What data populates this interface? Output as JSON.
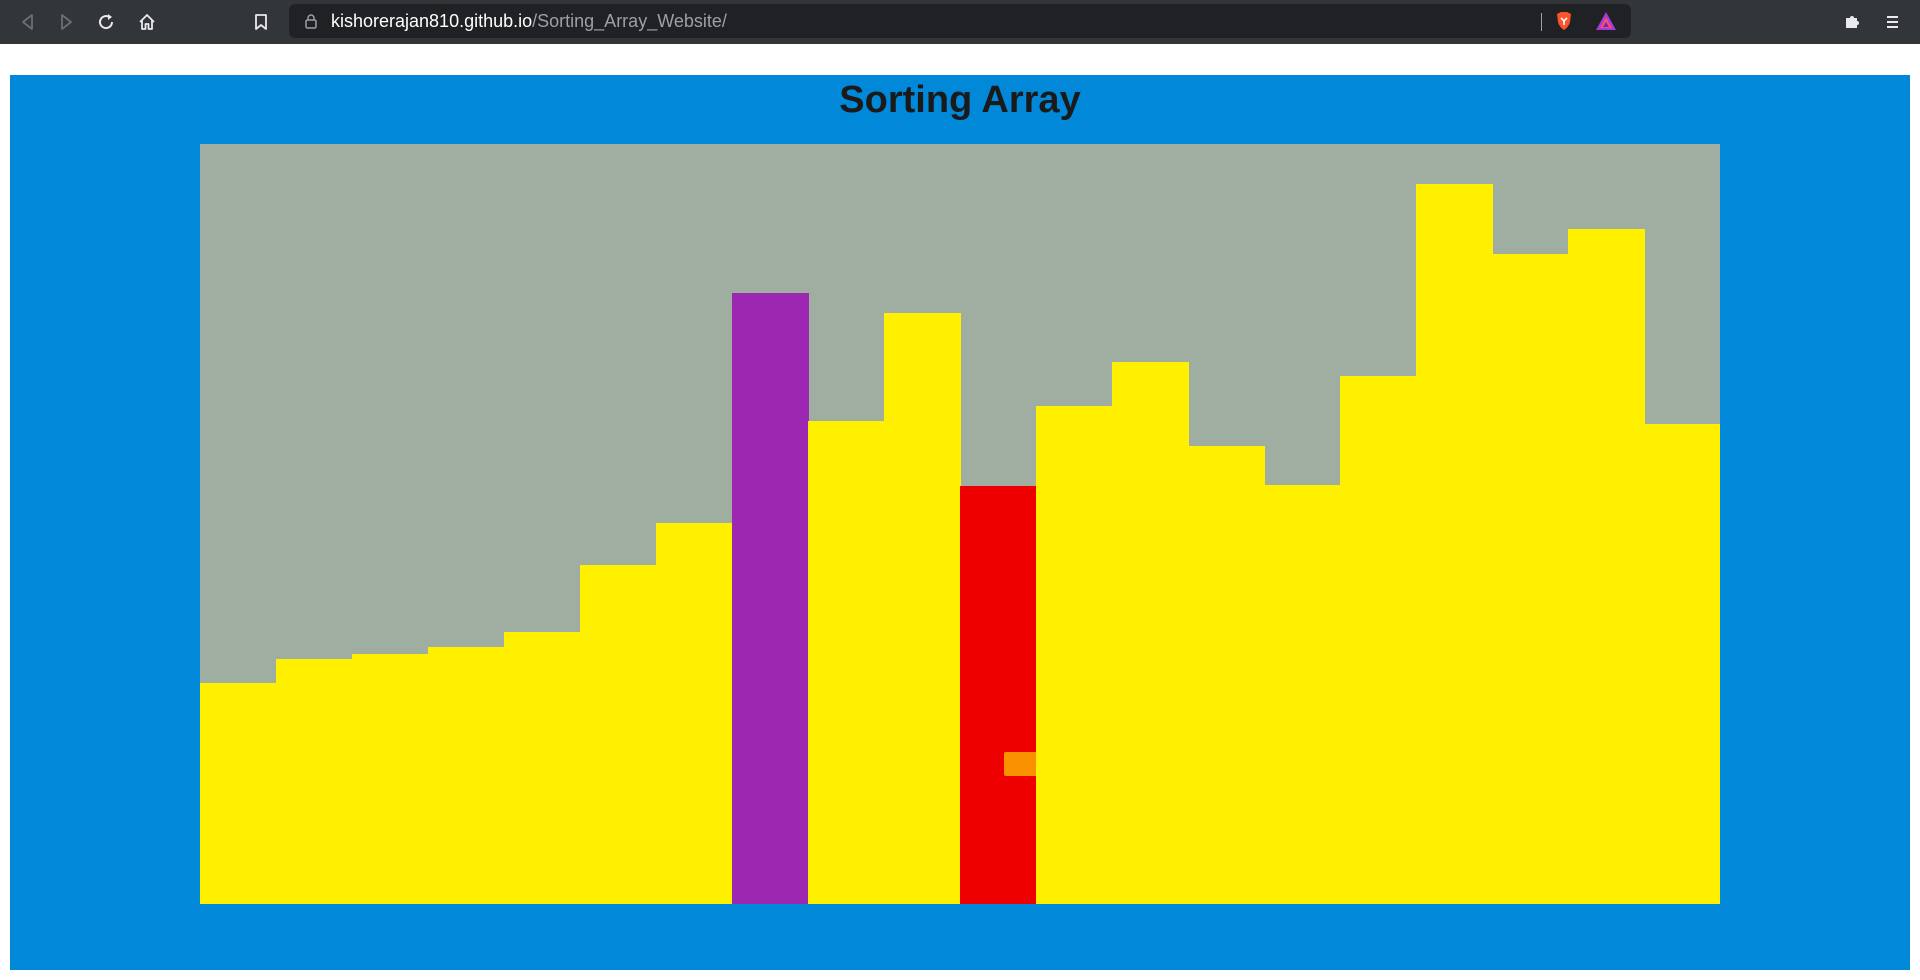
{
  "browser": {
    "url_host": "kishorerajan810.github.io",
    "url_path": "/Sorting_Array_Website/"
  },
  "page": {
    "title": "Sorting Array"
  },
  "array": {
    "colors": {
      "default": "#fff000",
      "comparing": "#9c27b0",
      "swapping": "#ee0000",
      "background": "#a0aea2",
      "frame": "#0288d9"
    },
    "max_value": 760,
    "values": [
      {
        "value": 221,
        "state": "default"
      },
      {
        "value": 245,
        "state": "default"
      },
      {
        "value": 250,
        "state": "default"
      },
      {
        "value": 257,
        "state": "default"
      },
      {
        "value": 272,
        "state": "default"
      },
      {
        "value": 339,
        "state": "default"
      },
      {
        "value": 381,
        "state": "default"
      },
      {
        "value": 611,
        "state": "comparing"
      },
      {
        "value": 483,
        "state": "default"
      },
      {
        "value": 591,
        "state": "default"
      },
      {
        "value": 418,
        "state": "swapping"
      },
      {
        "value": 498,
        "state": "default"
      },
      {
        "value": 542,
        "state": "default"
      },
      {
        "value": 458,
        "state": "default"
      },
      {
        "value": 419,
        "state": "default"
      },
      {
        "value": 528,
        "state": "default"
      },
      {
        "value": 720,
        "state": "default"
      },
      {
        "value": 650,
        "state": "default"
      },
      {
        "value": 675,
        "state": "default"
      },
      {
        "value": 480,
        "state": "default"
      }
    ]
  }
}
